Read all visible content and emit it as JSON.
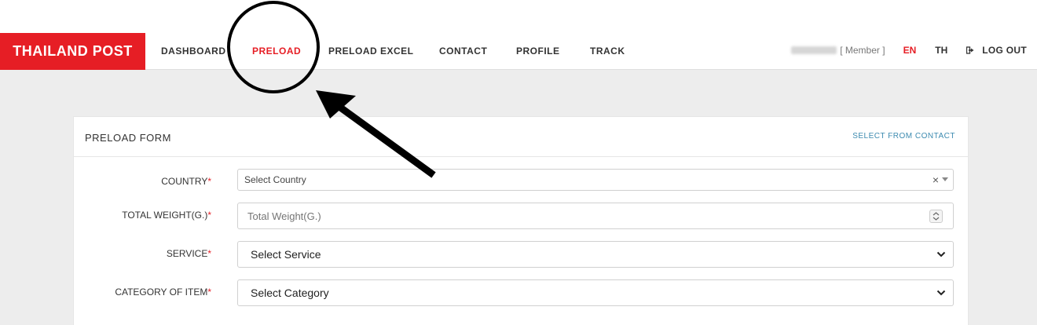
{
  "header": {
    "brand": "THAILAND POST",
    "nav": [
      {
        "label": "DASHBOARD"
      },
      {
        "label": "PRELOAD"
      },
      {
        "label": "PRELOAD EXCEL"
      },
      {
        "label": "CONTACT"
      },
      {
        "label": "PROFILE"
      },
      {
        "label": "TRACK"
      }
    ],
    "member_label": "[ Member ]",
    "lang_en": "EN",
    "lang_th": "TH",
    "logout_label": "LOG OUT"
  },
  "form": {
    "title": "PRELOAD FORM",
    "select_from_contact": "SELECT FROM CONTACT",
    "fields": [
      {
        "label": "COUNTRY",
        "required_mark": "*",
        "value": "Select Country",
        "clear_glyph": "×"
      },
      {
        "label": "TOTAL WEIGHT(G.)",
        "required_mark": "*",
        "placeholder": "Total Weight(G.)"
      },
      {
        "label": "SERVICE",
        "required_mark": "*",
        "value": "Select Service"
      },
      {
        "label": "CATEGORY OF ITEM",
        "required_mark": "*",
        "value": "Select Category"
      }
    ]
  },
  "colors": {
    "brand_red": "#e61e25",
    "link_blue": "#3d8bb0",
    "page_bg": "#ededed"
  }
}
